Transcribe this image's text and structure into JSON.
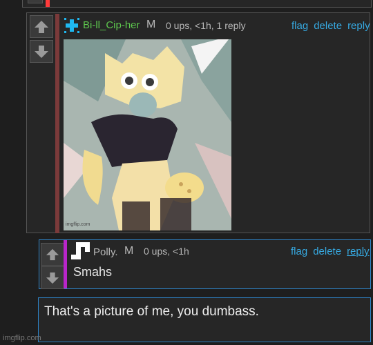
{
  "comments": [
    {
      "username": "Bi-ll_Cip-her",
      "mod_label": "M",
      "meta": "0 ups, <1h, 1 reply",
      "actions": {
        "flag": "flag",
        "delete": "delete",
        "reply": "reply"
      },
      "avatar_icon": "blue-cross-icon",
      "accent_color": "#7b3a3a",
      "image_watermark": "imgflip.com"
    },
    {
      "username": "Polly.",
      "mod_label": "M",
      "meta": "0 ups, <1h",
      "actions": {
        "flag": "flag",
        "delete": "delete",
        "reply": "reply"
      },
      "avatar_icon": "pixel-glyph-icon",
      "accent_color": "#b825c9",
      "text": "Smahs"
    }
  ],
  "reply_input": {
    "value": "That's a picture of me, you dumbass."
  },
  "watermark": "imgflip.com",
  "colors": {
    "link": "#36a9e1",
    "username_green": "#5ec84e",
    "focus_border": "#2e84c8"
  }
}
